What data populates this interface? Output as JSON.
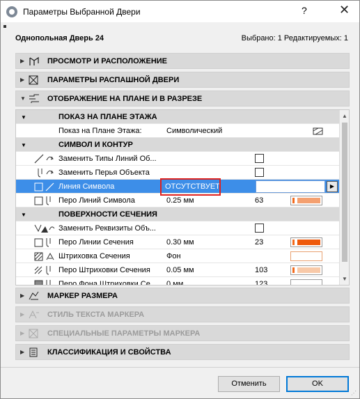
{
  "window": {
    "title": "Параметры Выбранной Двери",
    "help": "?",
    "close": "✕"
  },
  "header": {
    "subject": "Однопольная Дверь 24",
    "selection_info": "Выбрано: 1 Редактируемых: 1"
  },
  "sections_top": [
    {
      "label": "ПРОСМОТР И РАСПОЛОЖЕНИЕ",
      "icon": "view-placement-icon",
      "expanded": false
    },
    {
      "label": "ПАРАМЕТРЫ РАСПАШНОЙ ДВЕРИ",
      "icon": "door-params-icon",
      "expanded": false
    },
    {
      "label": "ОТОБРАЖЕНИЕ НА ПЛАНЕ И В РАЗРЕЗЕ",
      "icon": "plan-section-icon",
      "expanded": true
    }
  ],
  "groups": {
    "floor_plan": "ПОКАЗ НА ПЛАНЕ ЭТАЖА",
    "symbol": "СИМВОЛ И КОНТУР",
    "cut_surfaces": "ПОВЕРХНОСТИ СЕЧЕНИЯ"
  },
  "rows": {
    "floor_plan_display": {
      "label": "Показ на Плане Этажа:",
      "value": "Символический"
    },
    "override_line_types": {
      "label": "Заменить Типы Линий Об..."
    },
    "override_pens": {
      "label": "Заменить Перья Объекта"
    },
    "symbol_line": {
      "label": "Линия Символа",
      "value": "ОТСУТСТВУЕТ"
    },
    "symbol_line_pen": {
      "label": "Перо Линий Символа",
      "value": "0.25 мм",
      "num": "63"
    },
    "override_attributes": {
      "label": "Заменить Реквизиты Объ..."
    },
    "cut_line_pen": {
      "label": "Перо Линии Сечения",
      "value": "0.30 мм",
      "num": "23"
    },
    "hatch": {
      "label": "Штриховка Сечения",
      "value": "Фон"
    },
    "hatch_pen": {
      "label": "Перо Штриховки Сечения",
      "value": "0.05 мм",
      "num": "103"
    },
    "bg_pen": {
      "label": "Перо Фона Штриховки Се...",
      "value": "0 мм",
      "num": "123"
    }
  },
  "sections_bottom": [
    {
      "label": "МАРКЕР РАЗМЕРА",
      "icon": "dimension-marker-icon",
      "enabled": true
    },
    {
      "label": "СТИЛЬ ТЕКСТА МАРКЕРА",
      "icon": "marker-text-style-icon",
      "enabled": false
    },
    {
      "label": "СПЕЦИАЛЬНЫЕ ПАРАМЕТРЫ МАРКЕРА",
      "icon": "marker-special-icon",
      "enabled": false
    },
    {
      "label": "КЛАССИФИКАЦИЯ И СВОЙСТВА",
      "icon": "classification-icon",
      "enabled": true
    }
  ],
  "buttons": {
    "cancel": "Отменить",
    "ok": "OK"
  },
  "colors": {
    "selection": "#3d8ee8",
    "highlight_box": "#e0201c",
    "pen_orange": "#f46a1c",
    "pen_orange_dark": "#ee5a0c",
    "pen_light": "#f8c9a8"
  }
}
